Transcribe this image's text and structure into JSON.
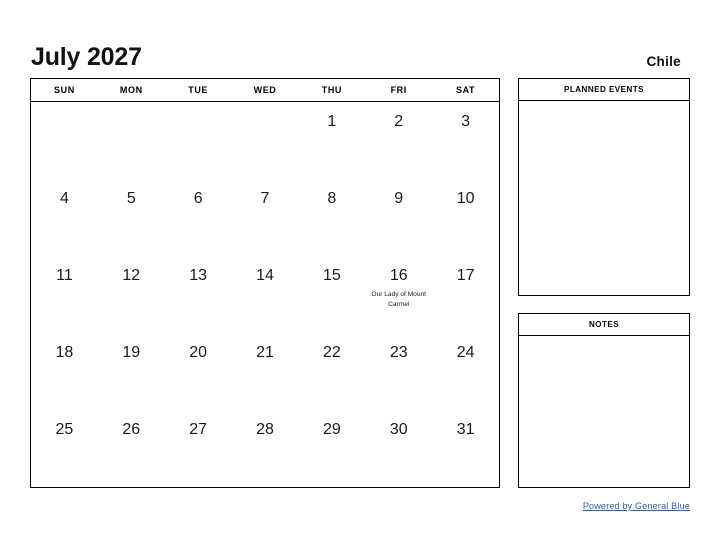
{
  "header": {
    "month_title": "July 2027",
    "country": "Chile"
  },
  "calendar": {
    "day_headers": [
      "SUN",
      "MON",
      "TUE",
      "WED",
      "THU",
      "FRI",
      "SAT"
    ],
    "weeks": [
      [
        {
          "day": "",
          "event": ""
        },
        {
          "day": "",
          "event": ""
        },
        {
          "day": "",
          "event": ""
        },
        {
          "day": "",
          "event": ""
        },
        {
          "day": "1",
          "event": ""
        },
        {
          "day": "2",
          "event": ""
        },
        {
          "day": "3",
          "event": ""
        }
      ],
      [
        {
          "day": "4",
          "event": ""
        },
        {
          "day": "5",
          "event": ""
        },
        {
          "day": "6",
          "event": ""
        },
        {
          "day": "7",
          "event": ""
        },
        {
          "day": "8",
          "event": ""
        },
        {
          "day": "9",
          "event": ""
        },
        {
          "day": "10",
          "event": ""
        }
      ],
      [
        {
          "day": "11",
          "event": ""
        },
        {
          "day": "12",
          "event": ""
        },
        {
          "day": "13",
          "event": ""
        },
        {
          "day": "14",
          "event": ""
        },
        {
          "day": "15",
          "event": ""
        },
        {
          "day": "16",
          "event": "Our Lady of Mount Carmel"
        },
        {
          "day": "17",
          "event": ""
        }
      ],
      [
        {
          "day": "18",
          "event": ""
        },
        {
          "day": "19",
          "event": ""
        },
        {
          "day": "20",
          "event": ""
        },
        {
          "day": "21",
          "event": ""
        },
        {
          "day": "22",
          "event": ""
        },
        {
          "day": "23",
          "event": ""
        },
        {
          "day": "24",
          "event": ""
        }
      ],
      [
        {
          "day": "25",
          "event": ""
        },
        {
          "day": "26",
          "event": ""
        },
        {
          "day": "27",
          "event": ""
        },
        {
          "day": "28",
          "event": ""
        },
        {
          "day": "29",
          "event": ""
        },
        {
          "day": "30",
          "event": ""
        },
        {
          "day": "31",
          "event": ""
        }
      ]
    ]
  },
  "panels": {
    "planned_events": {
      "title": "PLANNED EVENTS",
      "content": ""
    },
    "notes": {
      "title": "NOTES",
      "content": ""
    }
  },
  "footer": {
    "link_label": "Powered by General Blue"
  },
  "colors": {
    "page_background": "#ffffff",
    "border": "#000000",
    "text": "#111111",
    "link": "#2b5fb8"
  }
}
